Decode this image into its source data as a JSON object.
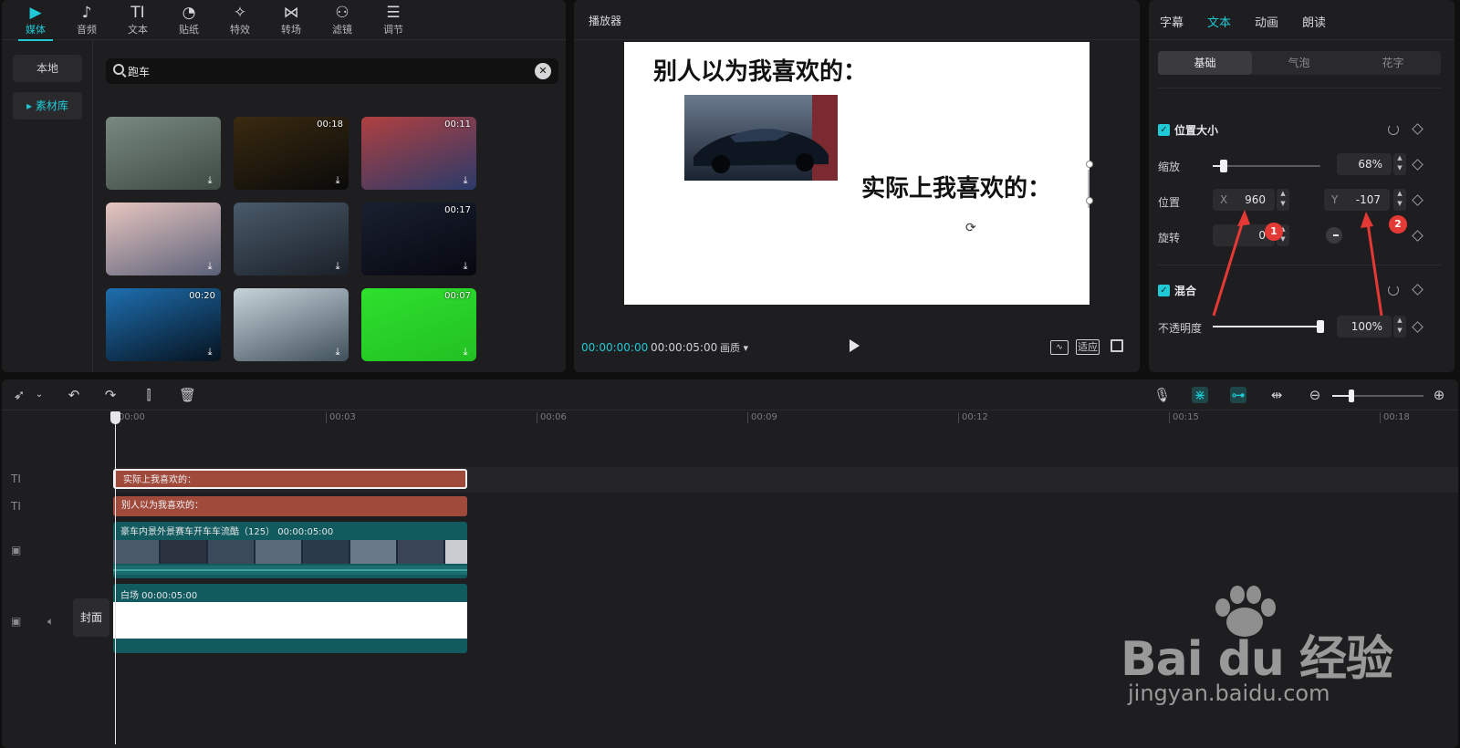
{
  "top_toolbar": {
    "tools": [
      {
        "label": "媒体",
        "icon": "media-icon",
        "glyph": "▶"
      },
      {
        "label": "音频",
        "icon": "audio-icon",
        "glyph": "♪"
      },
      {
        "label": "文本",
        "icon": "text-icon",
        "glyph": "TI"
      },
      {
        "label": "贴纸",
        "icon": "sticker-icon",
        "glyph": "◔"
      },
      {
        "label": "特效",
        "icon": "effects-icon",
        "glyph": "✧"
      },
      {
        "label": "转场",
        "icon": "transition-icon",
        "glyph": "⋈"
      },
      {
        "label": "滤镜",
        "icon": "filter-icon",
        "glyph": "⚇"
      },
      {
        "label": "调节",
        "icon": "adjust-icon",
        "glyph": "☰"
      }
    ]
  },
  "left_nav": {
    "local": "本地",
    "library": "▸ 素材库"
  },
  "search": {
    "value": "跑车",
    "clear": "✕"
  },
  "media_grid": [
    {
      "duration": "",
      "colors": [
        "#7a8a80",
        "#3d4a44"
      ]
    },
    {
      "duration": "00:18",
      "colors": [
        "#3a2a10",
        "#0a0a0a"
      ]
    },
    {
      "duration": "00:11",
      "colors": [
        "#b04040",
        "#2a3a6a"
      ]
    },
    {
      "duration": "",
      "colors": [
        "#e7c6c0",
        "#5a6078"
      ]
    },
    {
      "duration": "",
      "colors": [
        "#4a5a6a",
        "#1a2028"
      ]
    },
    {
      "duration": "00:17",
      "colors": [
        "#1a2030",
        "#060810"
      ]
    },
    {
      "duration": "00:20",
      "colors": [
        "#1e6fb0",
        "#06121e"
      ]
    },
    {
      "duration": "",
      "colors": [
        "#c8d4dc",
        "#40505a"
      ]
    },
    {
      "duration": "00:07",
      "colors": [
        "#2ee02e",
        "#22c022"
      ]
    }
  ],
  "player": {
    "title": "播放器",
    "canvas_text1": "别人以为我喜欢的：",
    "canvas_text2": "实际上我喜欢的：",
    "time_current": "00:00:00:00",
    "time_total": "00:00:05:00",
    "quality": "画质 ▾",
    "fit": "适应"
  },
  "inspector": {
    "tabs": [
      "字幕",
      "文本",
      "动画",
      "朗读"
    ],
    "sub_tabs": [
      "基础",
      "气泡",
      "花字"
    ],
    "section_pos": "位置大小",
    "scale_label": "缩放",
    "scale_value": "68%",
    "scale_level": 0.1,
    "pos_label": "位置",
    "x_prefix": "X",
    "x_value": "960",
    "y_prefix": "Y",
    "y_value": "-107",
    "rotate_label": "旋转",
    "rotate_value": "0",
    "section_blend": "混合",
    "opacity_label": "不透明度",
    "opacity_value": "100%",
    "opacity_level": 1.0
  },
  "annotations": {
    "badge1": "1",
    "badge2": "2",
    "color": "#e53935"
  },
  "timeline": {
    "ticks": [
      "00:00",
      "00:03",
      "00:06",
      "00:09",
      "00:12",
      "00:15",
      "00:18"
    ],
    "text_clip1": "实际上我喜欢的：",
    "text_clip2": "别人以为我喜欢的：",
    "video_clip_name": "豪车内景外景赛车开车车流酷（125）  00:00:05:00",
    "white_clip_name": "白场   00:00:05:00",
    "cover_label": "封面",
    "zoom_level": 0.22
  },
  "watermark": {
    "logo": "Bai du 经验",
    "url": "jingyan.baidu.com"
  },
  "colors": {
    "accent": "#1fc9d6",
    "text_clip": "#a04a3c",
    "video_clip": "#115a5e"
  }
}
